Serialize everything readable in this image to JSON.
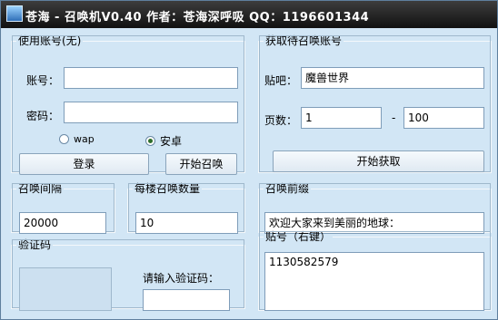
{
  "window": {
    "title": "苍海 - 召唤机V0.40  作者：苍海深呼吸  QQ：1196601344"
  },
  "account_group": {
    "title": "使用账号(无)",
    "account_label": "账号：",
    "account_value": "",
    "password_label": "密码：",
    "password_value": "",
    "radio_wap": "wap",
    "radio_android": "安卓",
    "selected": "安卓",
    "login_button": "登录",
    "start_summon_button": "开始召唤"
  },
  "fetch_group": {
    "title": "获取待召唤账号",
    "tieba_label": "贴吧：",
    "tieba_value": "魔兽世界",
    "pages_label": "页数：",
    "page_from": "1",
    "dash": "-",
    "page_to": "100",
    "start_fetch_button": "开始获取"
  },
  "interval_group": {
    "title": "召唤间隔",
    "value": "20000"
  },
  "per_floor_group": {
    "title": "每楼召唤数量",
    "value": "10"
  },
  "prefix_group": {
    "title": "召唤前缀",
    "value": "欢迎大家来到美丽的地球："
  },
  "captcha_group": {
    "title": "验证码",
    "input_label": "请输入验证码：",
    "value": ""
  },
  "post_group": {
    "title": "贴号（右键）",
    "value": "1130582579"
  }
}
